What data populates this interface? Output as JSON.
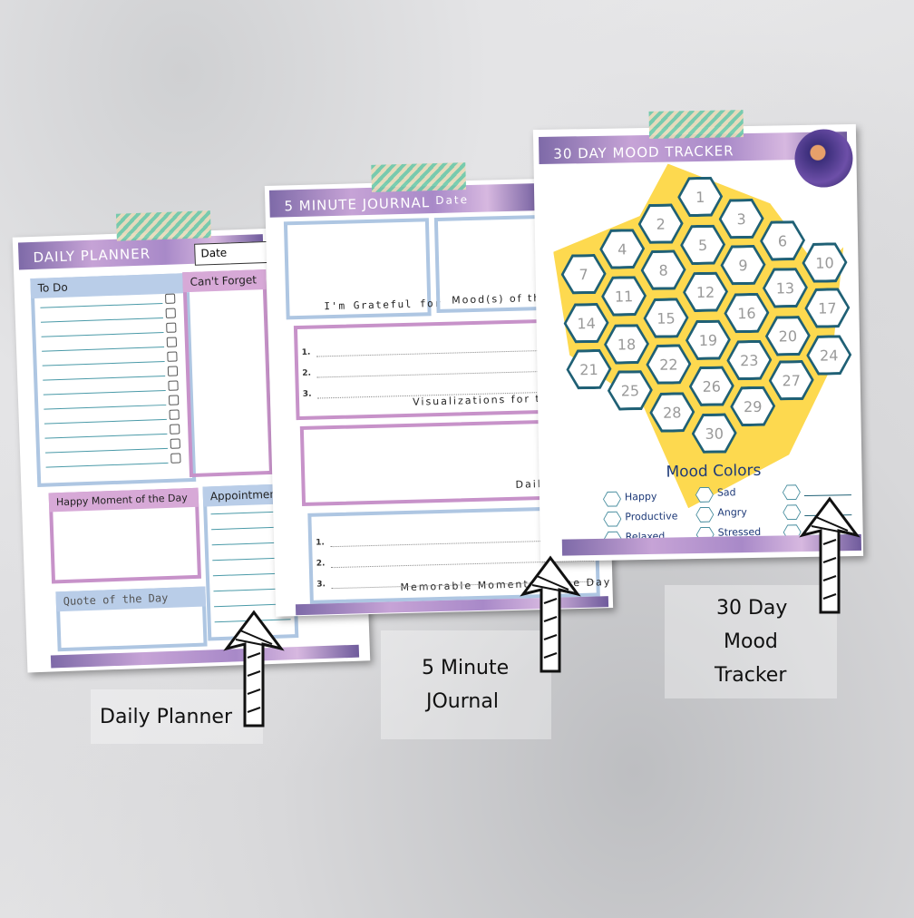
{
  "daily_planner": {
    "title": "DAILY PLANNER",
    "date_label": "Date",
    "todo": "To Do",
    "cant_forget": "Can't Forget",
    "happy_moment": "Happy Moment of the Day",
    "appointments": "Appointments",
    "quote": "Quote of the Day"
  },
  "journal": {
    "title": "5 MINUTE JOURNAL",
    "date_label": "Date",
    "grateful": "I'm Grateful for",
    "moods": "Mood(s) of the",
    "visualizations": "Visualizations for the",
    "daily": "Daily C",
    "memorable": "Memorable Moments of the Day",
    "n1": "1.",
    "n2": "2.",
    "n3": "3."
  },
  "mood_tracker": {
    "title": "30 DAY MOOD TRACKER",
    "days": [
      "1",
      "2",
      "3",
      "4",
      "5",
      "6",
      "7",
      "8",
      "9",
      "10",
      "11",
      "12",
      "13",
      "14",
      "15",
      "16",
      "17",
      "18",
      "19",
      "20",
      "21",
      "22",
      "23",
      "24",
      "25",
      "26",
      "27",
      "28",
      "29",
      "30"
    ],
    "legend_title": "Mood Colors",
    "moods": [
      "Happy",
      "Productive",
      "Relaxed",
      "Sad",
      "Angry",
      "Stressed"
    ]
  },
  "captions": {
    "daily": "Daily Planner",
    "journal_1": "5 Minute",
    "journal_2": "JOurnal",
    "mood_1": "30 Day",
    "mood_2": "Mood",
    "mood_3": "Tracker"
  },
  "colors": {
    "blue": "#aec6e2",
    "pink": "#c792c9",
    "yellow": "#fdd94f",
    "teal": "#1f6075"
  }
}
